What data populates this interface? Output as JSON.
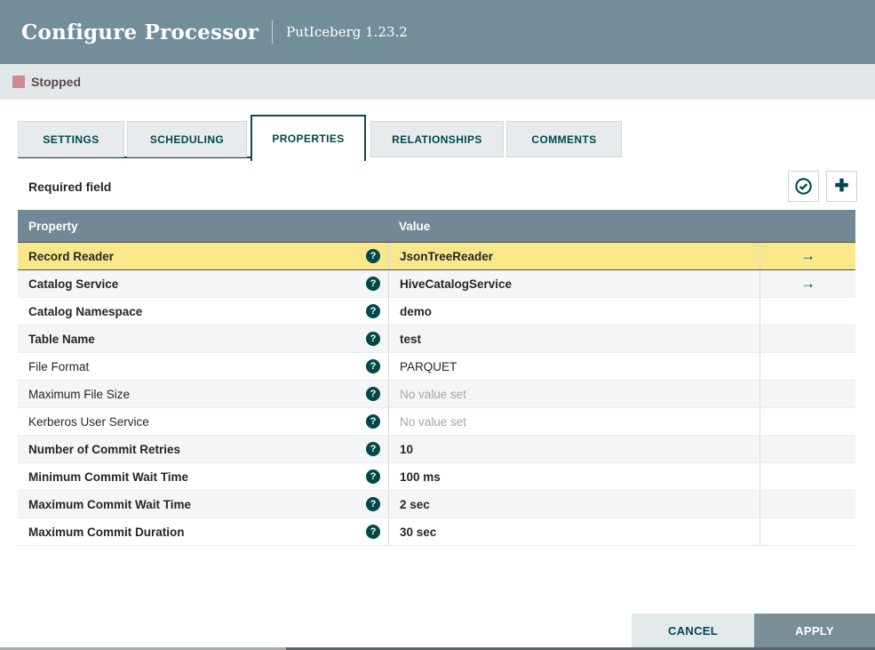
{
  "header": {
    "title": "Configure Processor",
    "subtitle": "PutIceberg 1.23.2"
  },
  "status": {
    "label": "Stopped",
    "indicator_color": "#CD8B91"
  },
  "tabs": [
    {
      "id": "settings",
      "label": "SETTINGS",
      "active": false
    },
    {
      "id": "scheduling",
      "label": "SCHEDULING",
      "active": false
    },
    {
      "id": "properties",
      "label": "PROPERTIES",
      "active": true
    },
    {
      "id": "relationships",
      "label": "RELATIONSHIPS",
      "active": false
    },
    {
      "id": "comments",
      "label": "COMMENTS",
      "active": false
    }
  ],
  "toolbar": {
    "required_label": "Required field",
    "buttons": [
      {
        "id": "verify-properties",
        "icon": "check-circle-icon"
      },
      {
        "id": "add-property",
        "icon": "plus-icon"
      }
    ]
  },
  "table": {
    "columns": {
      "property": "Property",
      "value": "Value"
    },
    "rows": [
      {
        "name": "Record Reader",
        "required": true,
        "value": "JsonTreeReader",
        "value_set": true,
        "has_arrow": true,
        "selected": true
      },
      {
        "name": "Catalog Service",
        "required": true,
        "value": "HiveCatalogService",
        "value_set": true,
        "has_arrow": true,
        "selected": false
      },
      {
        "name": "Catalog Namespace",
        "required": true,
        "value": "demo",
        "value_set": true,
        "has_arrow": false,
        "selected": false
      },
      {
        "name": "Table Name",
        "required": true,
        "value": "test",
        "value_set": true,
        "has_arrow": false,
        "selected": false
      },
      {
        "name": "File Format",
        "required": false,
        "value": "PARQUET",
        "value_set": true,
        "has_arrow": false,
        "selected": false
      },
      {
        "name": "Maximum File Size",
        "required": false,
        "value": "No value set",
        "value_set": false,
        "has_arrow": false,
        "selected": false
      },
      {
        "name": "Kerberos User Service",
        "required": false,
        "value": "No value set",
        "value_set": false,
        "has_arrow": false,
        "selected": false
      },
      {
        "name": "Number of Commit Retries",
        "required": true,
        "value": "10",
        "value_set": true,
        "has_arrow": false,
        "selected": false
      },
      {
        "name": "Minimum Commit Wait Time",
        "required": true,
        "value": "100 ms",
        "value_set": true,
        "has_arrow": false,
        "selected": false
      },
      {
        "name": "Maximum Commit Wait Time",
        "required": true,
        "value": "2 sec",
        "value_set": true,
        "has_arrow": false,
        "selected": false
      },
      {
        "name": "Maximum Commit Duration",
        "required": true,
        "value": "30 sec",
        "value_set": true,
        "has_arrow": false,
        "selected": false
      }
    ],
    "help_icon_glyph": "?",
    "arrow_glyph": "→"
  },
  "footer": {
    "cancel_label": "CANCEL",
    "apply_label": "APPLY"
  },
  "colors": {
    "header_bg": "#728E9B",
    "table_header_bg": "#728995",
    "accent_teal": "#004849",
    "selected_row_bg": "#F8E88A",
    "status_bar_bg": "#E2E7EA",
    "stopped_indicator": "#CD8B91",
    "apply_button_bg": "#7A8E98",
    "cancel_button_bg": "#E3E8EB"
  }
}
